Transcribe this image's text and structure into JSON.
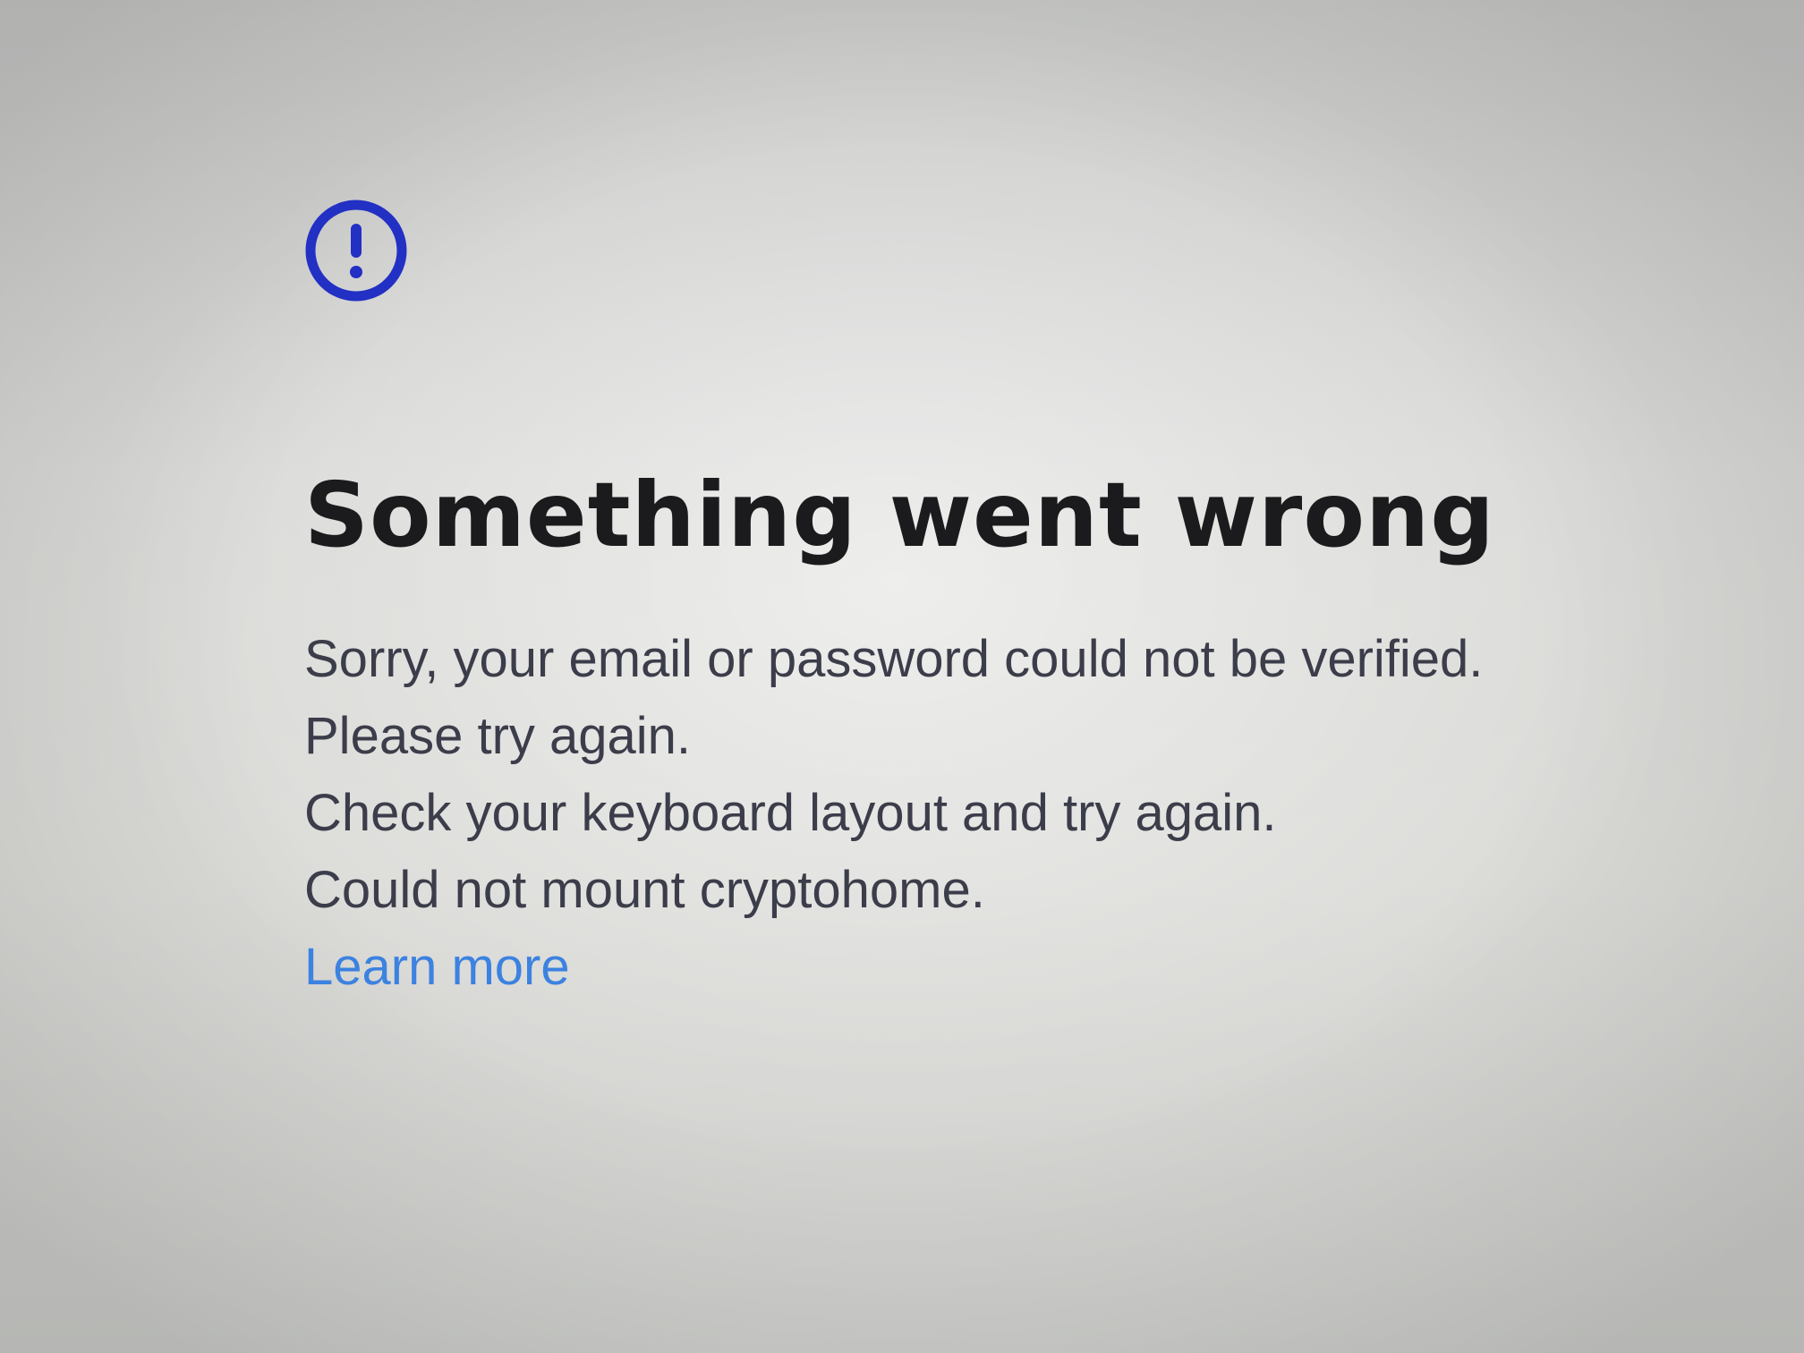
{
  "error": {
    "icon": "alert-circle-icon",
    "icon_color": "#2230c4",
    "title": "Something went wrong",
    "messages": [
      "Sorry, your email or password could not be verified.",
      "Please try again.",
      "Check your keyboard layout and try again.",
      "Could not mount cryptohome."
    ],
    "learn_more_label": "Learn more",
    "link_color": "#3c82e0"
  }
}
